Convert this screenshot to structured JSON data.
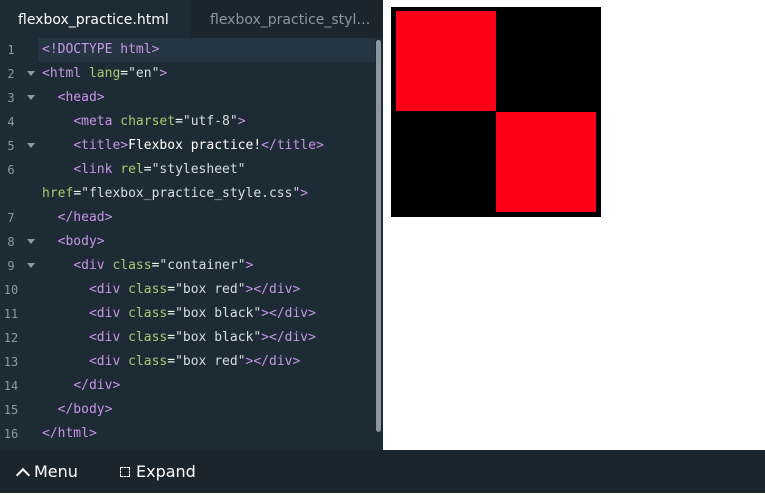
{
  "tabs": [
    {
      "label": "flexbox_practice.html",
      "active": true
    },
    {
      "label": "flexbox_practice_styl…",
      "active": false
    }
  ],
  "code_lines": [
    {
      "num": "1",
      "fold": false,
      "highlight": true,
      "tokens": [
        {
          "t": "tag",
          "v": "<!DOCTYPE html>"
        }
      ]
    },
    {
      "num": "2",
      "fold": true,
      "tokens": [
        {
          "t": "tag",
          "v": "<html "
        },
        {
          "t": "attr",
          "v": "lang"
        },
        {
          "t": "txt",
          "v": "="
        },
        {
          "t": "str",
          "v": "\"en\""
        },
        {
          "t": "tag",
          "v": ">"
        }
      ]
    },
    {
      "num": "3",
      "fold": true,
      "tokens": [
        {
          "t": "txt",
          "v": "  "
        },
        {
          "t": "tag",
          "v": "<head>"
        }
      ]
    },
    {
      "num": "4",
      "fold": false,
      "tokens": [
        {
          "t": "txt",
          "v": "    "
        },
        {
          "t": "tag",
          "v": "<meta "
        },
        {
          "t": "attr",
          "v": "charset"
        },
        {
          "t": "txt",
          "v": "="
        },
        {
          "t": "str",
          "v": "\"utf-8\""
        },
        {
          "t": "tag",
          "v": ">"
        }
      ]
    },
    {
      "num": "5",
      "fold": true,
      "tokens": [
        {
          "t": "txt",
          "v": "    "
        },
        {
          "t": "tag",
          "v": "<title>"
        },
        {
          "t": "txt",
          "v": "Flexbox practice!"
        },
        {
          "t": "tag",
          "v": "</title>"
        }
      ]
    },
    {
      "num": "6",
      "fold": false,
      "tokens": [
        {
          "t": "txt",
          "v": "    "
        },
        {
          "t": "tag",
          "v": "<link "
        },
        {
          "t": "attr",
          "v": "rel"
        },
        {
          "t": "txt",
          "v": "="
        },
        {
          "t": "str",
          "v": "\"stylesheet\""
        }
      ]
    },
    {
      "num": "",
      "fold": false,
      "tokens": [
        {
          "t": "attr",
          "v": "href"
        },
        {
          "t": "txt",
          "v": "="
        },
        {
          "t": "str",
          "v": "\"flexbox_practice_style.css\""
        },
        {
          "t": "tag",
          "v": ">"
        }
      ]
    },
    {
      "num": "7",
      "fold": false,
      "tokens": [
        {
          "t": "txt",
          "v": "  "
        },
        {
          "t": "tag",
          "v": "</head>"
        }
      ]
    },
    {
      "num": "8",
      "fold": true,
      "tokens": [
        {
          "t": "txt",
          "v": "  "
        },
        {
          "t": "tag",
          "v": "<body>"
        }
      ]
    },
    {
      "num": "9",
      "fold": true,
      "tokens": [
        {
          "t": "txt",
          "v": "    "
        },
        {
          "t": "tag",
          "v": "<div "
        },
        {
          "t": "attr",
          "v": "class"
        },
        {
          "t": "txt",
          "v": "="
        },
        {
          "t": "str",
          "v": "\"container\""
        },
        {
          "t": "tag",
          "v": ">"
        }
      ]
    },
    {
      "num": "10",
      "fold": false,
      "tokens": [
        {
          "t": "txt",
          "v": "      "
        },
        {
          "t": "tag",
          "v": "<div "
        },
        {
          "t": "attr",
          "v": "class"
        },
        {
          "t": "txt",
          "v": "="
        },
        {
          "t": "str",
          "v": "\"box red\""
        },
        {
          "t": "tag",
          "v": "></div>"
        }
      ]
    },
    {
      "num": "11",
      "fold": false,
      "tokens": [
        {
          "t": "txt",
          "v": "      "
        },
        {
          "t": "tag",
          "v": "<div "
        },
        {
          "t": "attr",
          "v": "class"
        },
        {
          "t": "txt",
          "v": "="
        },
        {
          "t": "str",
          "v": "\"box black\""
        },
        {
          "t": "tag",
          "v": "></div>"
        }
      ]
    },
    {
      "num": "12",
      "fold": false,
      "tokens": [
        {
          "t": "txt",
          "v": "      "
        },
        {
          "t": "tag",
          "v": "<div "
        },
        {
          "t": "attr",
          "v": "class"
        },
        {
          "t": "txt",
          "v": "="
        },
        {
          "t": "str",
          "v": "\"box black\""
        },
        {
          "t": "tag",
          "v": "></div>"
        }
      ]
    },
    {
      "num": "13",
      "fold": false,
      "tokens": [
        {
          "t": "txt",
          "v": "      "
        },
        {
          "t": "tag",
          "v": "<div "
        },
        {
          "t": "attr",
          "v": "class"
        },
        {
          "t": "txt",
          "v": "="
        },
        {
          "t": "str",
          "v": "\"box red\""
        },
        {
          "t": "tag",
          "v": "></div>"
        }
      ]
    },
    {
      "num": "14",
      "fold": false,
      "tokens": [
        {
          "t": "txt",
          "v": "    "
        },
        {
          "t": "tag",
          "v": "</div>"
        }
      ]
    },
    {
      "num": "15",
      "fold": false,
      "tokens": [
        {
          "t": "txt",
          "v": "  "
        },
        {
          "t": "tag",
          "v": "</body>"
        }
      ]
    },
    {
      "num": "16",
      "fold": false,
      "tokens": [
        {
          "t": "tag",
          "v": "</html>"
        }
      ]
    }
  ],
  "preview": {
    "boxes": [
      "#ff0019",
      "#000000",
      "#000000",
      "#ff0019"
    ]
  },
  "bottombar": {
    "menu_label": "Menu",
    "expand_label": "Expand"
  },
  "colors": {
    "editor_bg": "#1d2b35",
    "tag": "#c994e8",
    "attr": "#a8c870",
    "red_box": "#ff0019"
  },
  "icons": [
    "chevron-up-icon",
    "expand-icon",
    "fold-arrow-icon"
  ]
}
